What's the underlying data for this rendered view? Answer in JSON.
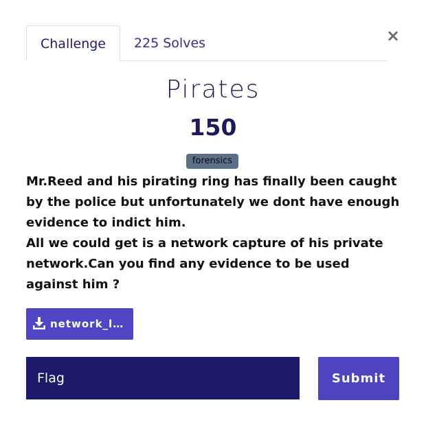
{
  "tabs": {
    "challenge": "Challenge",
    "solves": "225 Solves"
  },
  "close_icon": "×",
  "challenge": {
    "name": "Pirates",
    "points": "150",
    "category": "forensics",
    "description": [
      "Mr.Reed and his pirating ring has finally been caught by the police but unfortunately we dont have enough evidence to indict him.",
      "All we could get is a network capture of his private network.Can you find any evidence to be used against him ?"
    ],
    "file": {
      "icon": "download-icon",
      "name": "network_lis…"
    }
  },
  "form": {
    "flag_placeholder": "Flag",
    "submit_label": "Submit"
  },
  "colors": {
    "primary": "#4f46c6",
    "dark": "#1c1a6b",
    "badge": "#5d6f88"
  }
}
